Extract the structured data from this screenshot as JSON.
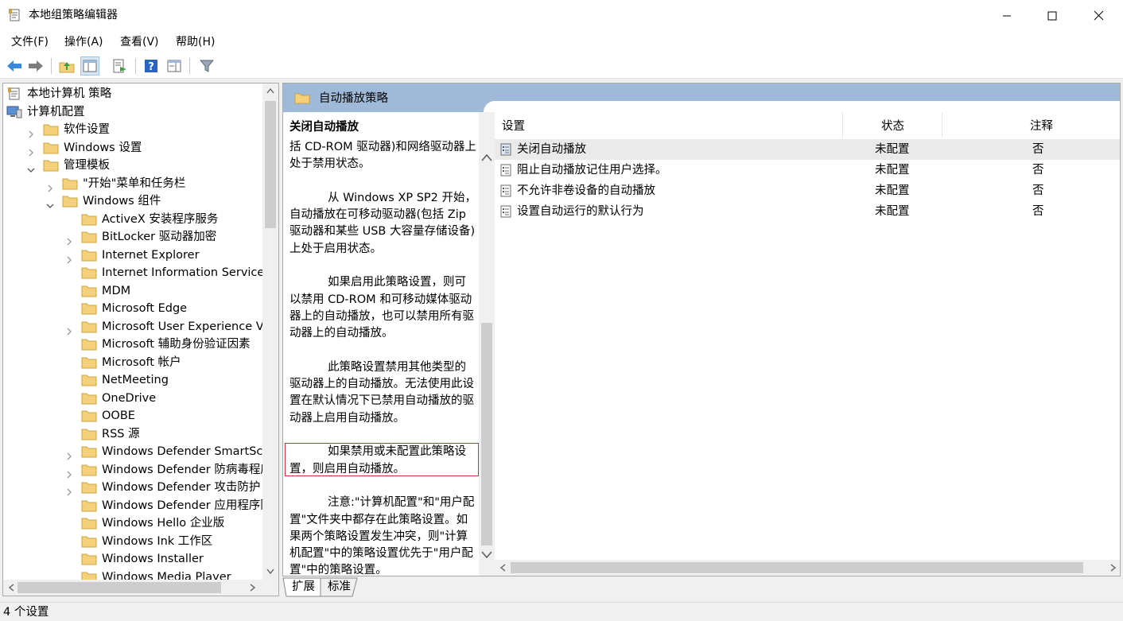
{
  "window": {
    "title": "本地组策略编辑器",
    "controls": {
      "minimize": "—",
      "maximize": "☐",
      "close": "✕"
    }
  },
  "menu": {
    "items": [
      {
        "label": "文件(F)"
      },
      {
        "label": "操作(A)"
      },
      {
        "label": "查看(V)"
      },
      {
        "label": "帮助(H)"
      }
    ]
  },
  "toolbar": {
    "buttons": [
      "back-icon",
      "forward-icon",
      "up-folder-icon",
      "show-hide-tree-icon",
      "export-list-icon",
      "help-icon",
      "extended-view-icon",
      "filter-icon"
    ]
  },
  "tree": {
    "items": [
      {
        "label": "本地计算机 策略"
      },
      {
        "label": "计算机配置"
      },
      {
        "label": "软件设置"
      },
      {
        "label": "Windows 设置"
      },
      {
        "label": "管理模板"
      },
      {
        "label": "\"开始\"菜单和任务栏"
      },
      {
        "label": "Windows 组件"
      },
      {
        "label": "ActiveX 安装程序服务"
      },
      {
        "label": "BitLocker 驱动器加密"
      },
      {
        "label": "Internet Explorer"
      },
      {
        "label": "Internet Information Services"
      },
      {
        "label": "MDM"
      },
      {
        "label": "Microsoft Edge"
      },
      {
        "label": "Microsoft User Experience Virtualization"
      },
      {
        "label": "Microsoft 辅助身份验证因素"
      },
      {
        "label": "Microsoft 帐户"
      },
      {
        "label": "NetMeeting"
      },
      {
        "label": "OneDrive"
      },
      {
        "label": "OOBE"
      },
      {
        "label": "RSS 源"
      },
      {
        "label": "Windows Defender SmartScreen"
      },
      {
        "label": "Windows Defender 防病毒程序"
      },
      {
        "label": "Windows Defender 攻击防护"
      },
      {
        "label": "Windows Defender 应用程序防护"
      },
      {
        "label": "Windows Hello 企业版"
      },
      {
        "label": "Windows Ink 工作区"
      },
      {
        "label": "Windows Installer"
      },
      {
        "label": "Windows Media Player"
      }
    ]
  },
  "right": {
    "header_title": "自动播放策略",
    "description": {
      "title": "关闭自动播放",
      "p1": "括 CD-ROM 驱动器)和网络驱动器上处于禁用状态。",
      "p2": "从 Windows XP SP2 开始，自动播放在可移动驱动器(包括 Zip 驱动器和某些 USB 大容量存储设备)上处于启用状态。",
      "p3": "如果启用此策略设置，则可以禁用 CD-ROM 和可移动媒体驱动器上的自动播放，也可以禁用所有驱动器上的自动播放。",
      "p4": "此策略设置禁用其他类型的驱动器上的自动播放。无法使用此设置在默认情况下已禁用自动播放的驱动器上启用自动播放。",
      "p5": "如果禁用或未配置此策略设置，则启用自动播放。",
      "p6": "注意:\"计算机配置\"和\"用户配置\"文件夹中都存在此策略设置。如果两个策略设置发生冲突，则\"计算机配置\"中的策略设置优先于\"用户配置\"中的策略设置。"
    },
    "columns": {
      "setting": "设置",
      "state": "状态",
      "note": "注释"
    },
    "rows": [
      {
        "name": "关闭自动播放",
        "state": "未配置",
        "note": "否",
        "selected": true
      },
      {
        "name": "阻止自动播放记住用户选择。",
        "state": "未配置",
        "note": "否"
      },
      {
        "name": "不允许非卷设备的自动播放",
        "state": "未配置",
        "note": "否"
      },
      {
        "name": "设置自动运行的默认行为",
        "state": "未配置",
        "note": "否"
      }
    ]
  },
  "tabs": [
    {
      "label": "扩展",
      "active": true
    },
    {
      "label": "标准",
      "active": false
    }
  ],
  "status": {
    "text": "4 个设置"
  },
  "colors": {
    "header_blue": "#9fb9d8",
    "folder_yellow": "#f5d07a",
    "highlight_red": "#d0342c",
    "selected_row": "#eaeaea"
  }
}
